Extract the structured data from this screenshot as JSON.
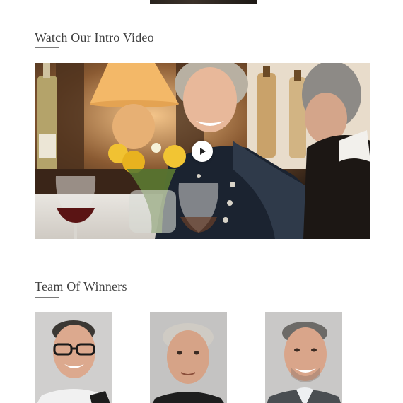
{
  "intro_section": {
    "title": "Watch Our Intro Video",
    "video": {
      "play_icon": "play-icon"
    }
  },
  "team_section": {
    "title": "Team Of Winners",
    "members": [
      {
        "photo": "team-member-photo"
      },
      {
        "photo": "team-member-photo"
      },
      {
        "photo": "team-member-photo"
      }
    ]
  },
  "colors": {
    "background": "#ffffff",
    "title_text": "#3f3f3f",
    "underline": "#7a7a7a"
  }
}
